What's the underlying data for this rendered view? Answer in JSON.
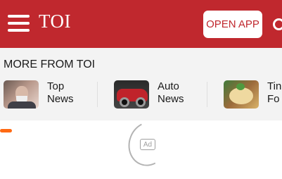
{
  "header": {
    "logo": "TOI",
    "open_app_label": "OPEN APP",
    "menu_icon": "hamburger-menu-icon",
    "search_icon": "search-icon",
    "background_color": "#c0282e"
  },
  "more_from": {
    "title": "MORE FROM TOI",
    "items": [
      {
        "line1": "Top",
        "line2": "News",
        "thumbnail": "news-thumbnail"
      },
      {
        "line1": "Auto",
        "line2": "News",
        "thumbnail": "car-thumbnail"
      },
      {
        "line1": "Tin",
        "line2": "Fo",
        "thumbnail": "food-thumbnail"
      }
    ]
  },
  "ad": {
    "badge": "Ad"
  }
}
